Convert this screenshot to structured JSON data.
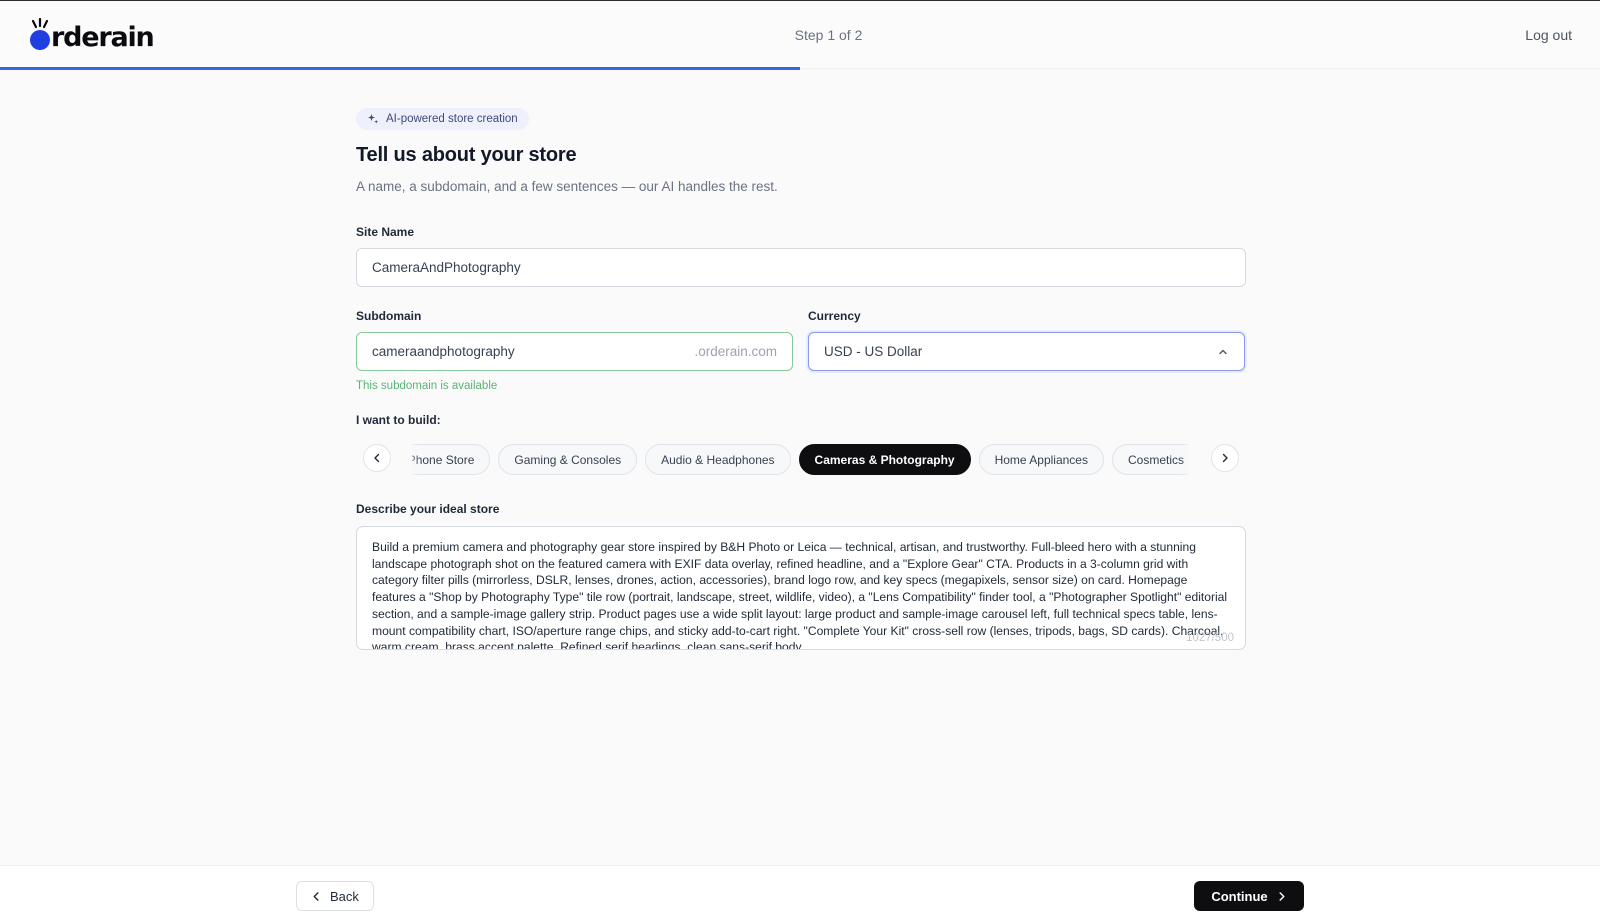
{
  "header": {
    "logo_text": "rderain",
    "step_text": "Step 1 of 2",
    "logout_label": "Log out",
    "progress_fraction": 0.5
  },
  "intro": {
    "badge_label": "AI-powered store creation",
    "title": "Tell us about your store",
    "subtitle": "A name, a subdomain, and a few sentences — our AI handles the rest."
  },
  "form": {
    "site_name": {
      "label": "Site Name",
      "value": "CameraAndPhotography"
    },
    "subdomain": {
      "label": "Subdomain",
      "value": "cameraandphotography",
      "suffix": ".orderain.com",
      "status": "This subdomain is available"
    },
    "currency": {
      "label": "Currency",
      "value": "USD - US Dollar"
    },
    "build": {
      "label": "I want to build:",
      "options": [
        {
          "label": "Mobile Phone Store",
          "selected": false
        },
        {
          "label": "Gaming & Consoles",
          "selected": false
        },
        {
          "label": "Audio & Headphones",
          "selected": false
        },
        {
          "label": "Cameras & Photography",
          "selected": true
        },
        {
          "label": "Home Appliances",
          "selected": false
        },
        {
          "label": "Cosmetics",
          "selected": false
        }
      ]
    },
    "description": {
      "label": "Describe your ideal store",
      "value": "Build a premium camera and photography gear store inspired by B&H Photo or Leica — technical, artisan, and trustworthy. Full-bleed hero with a stunning landscape photograph shot on the featured camera with EXIF data overlay, refined headline, and a \"Explore Gear\" CTA. Products in a 3-column grid with category filter pills (mirrorless, DSLR, lenses, drones, action, accessories), brand logo row, and key specs (megapixels, sensor size) on card. Homepage features a \"Shop by Photography Type\" tile row (portrait, landscape, street, wildlife, video), a \"Lens Compatibility\" finder tool, a \"Photographer Spotlight\" editorial section, and a sample-image gallery strip. Product pages use a wide split layout: large product and sample-image carousel left, full technical specs table, lens-mount compatibility chart, ISO/aperture range chips, and sticky add-to-cart right. \"Complete Your Kit\" cross-sell row (lenses, tripods, bags, SD cards). Charcoal, warm cream, brass accent palette. Refined serif headings, clean sans-serif body.",
      "counter": "1027/500"
    }
  },
  "footer": {
    "back_label": "Back",
    "continue_label": "Continue"
  },
  "colors": {
    "accent": "#3b63e6",
    "logo_blue": "#1f3fe0",
    "success": "#5bb374",
    "primary_button": "#0e0e10"
  }
}
